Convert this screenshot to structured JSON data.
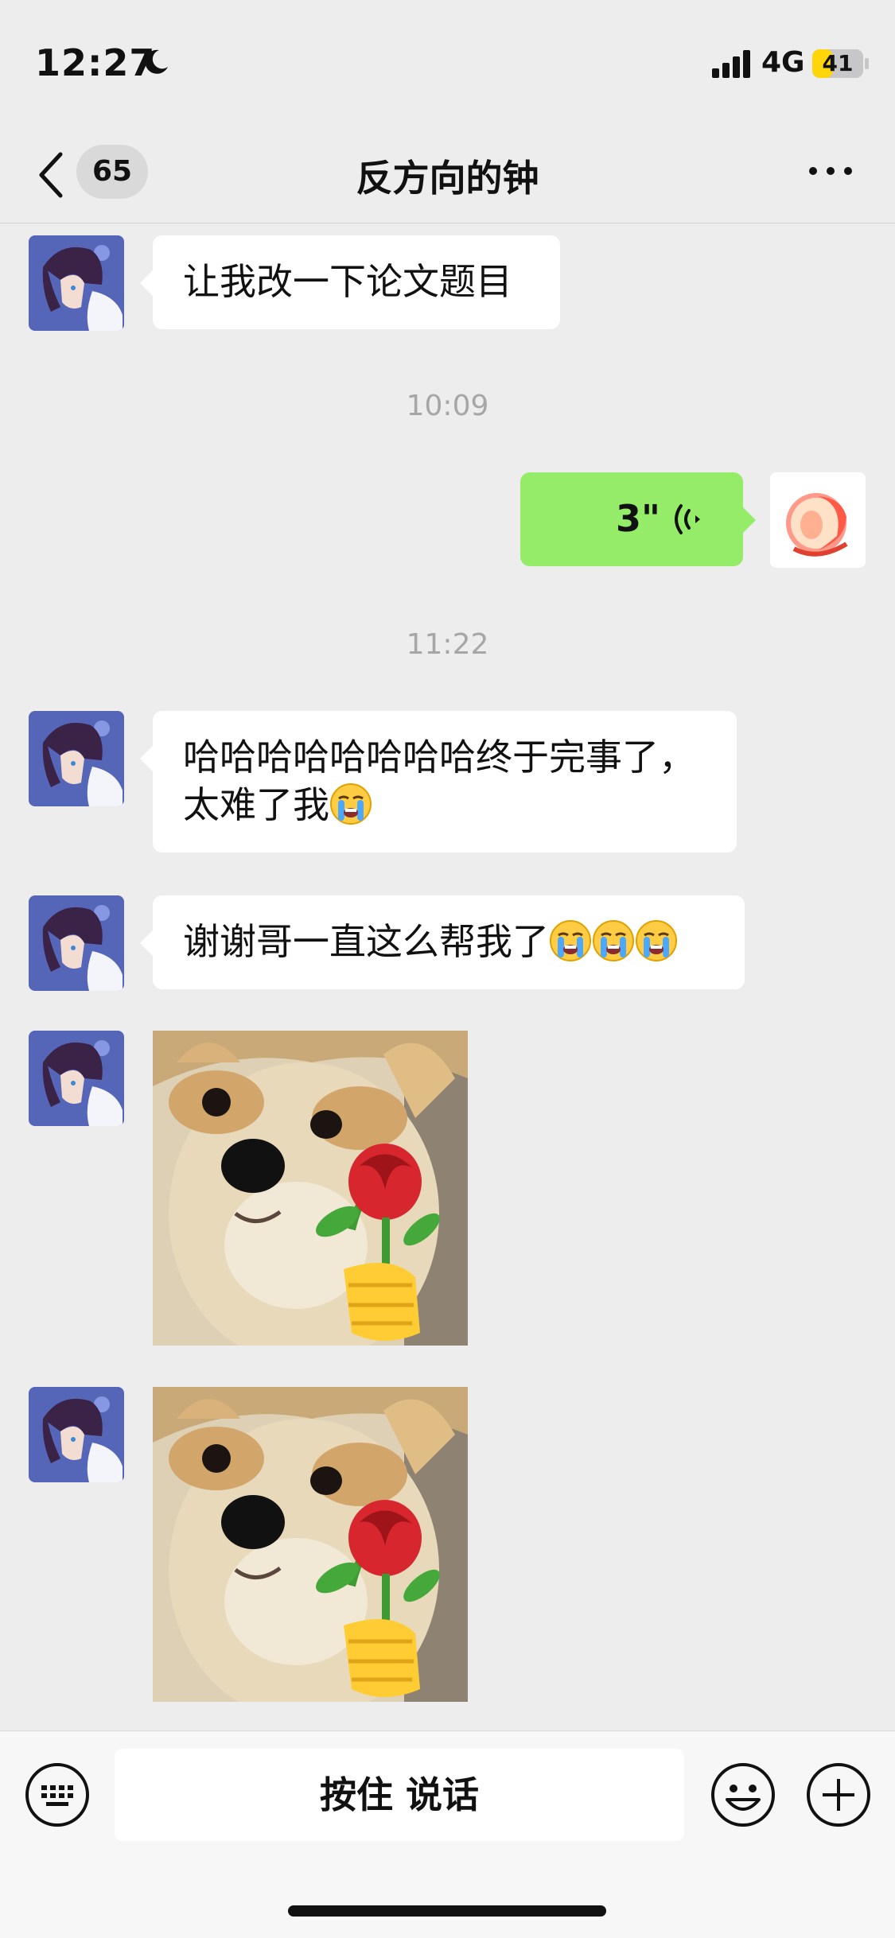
{
  "status_bar": {
    "time": "12:27",
    "network": "4G",
    "battery": "41",
    "battery_level": 0.41
  },
  "nav": {
    "unread_count": "65",
    "title": "反方向的钟"
  },
  "messages": [
    {
      "from": "other",
      "text": "让我改一下论文题目"
    },
    {
      "timestamp": "10:09"
    },
    {
      "from": "me",
      "voice_duration": "3\""
    },
    {
      "timestamp": "11:22"
    },
    {
      "from": "other",
      "text_line1": "哈哈哈哈哈哈哈哈终于完事了，",
      "text_line2": "太难了我"
    },
    {
      "from": "other",
      "text": "谢谢哥一直这么帮我了"
    },
    {
      "from": "other",
      "sticker": "shiba-with-rose"
    },
    {
      "from": "other",
      "sticker": "shiba-with-rose"
    }
  ],
  "input_bar": {
    "hold_to_talk": "按住 说话"
  },
  "icons": [
    "moon-icon",
    "signal-icon",
    "back-icon",
    "more-icon",
    "voice-wave-icon",
    "cry-emoji-icon",
    "keyboard-icon",
    "emoji-icon",
    "plus-icon"
  ],
  "colors": {
    "background": "#ededed",
    "my_bubble": "#95ec69",
    "their_bubble": "#ffffff",
    "battery": "#ffd60a"
  }
}
